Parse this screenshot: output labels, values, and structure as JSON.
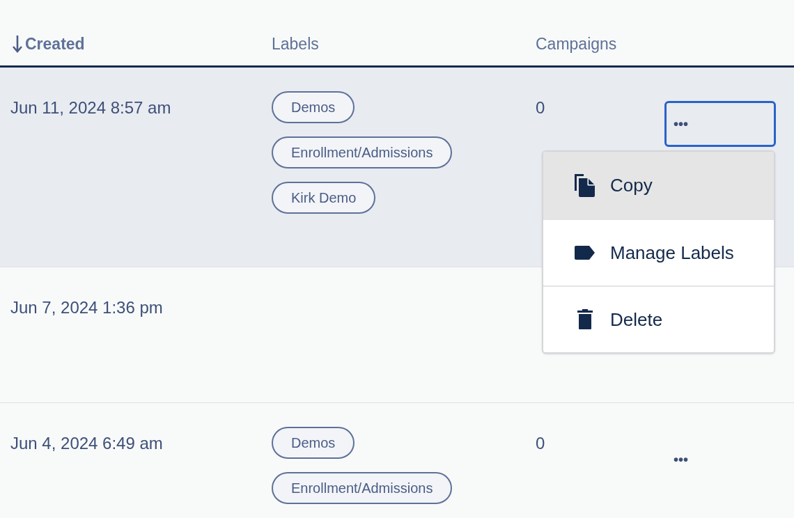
{
  "table": {
    "columns": [
      {
        "label": "Created",
        "sorted": true
      },
      {
        "label": "Labels",
        "sorted": false
      },
      {
        "label": "Campaigns",
        "sorted": false
      }
    ],
    "rows": [
      {
        "created": "Jun 11, 2024 8:57 am",
        "labels": [
          "Demos",
          "Enrollment/Admissions",
          "Kirk Demo"
        ],
        "campaigns": "0",
        "selected": true,
        "actions": {
          "label": "•••",
          "focused": true
        }
      },
      {
        "created": "Jun 7, 2024 1:36 pm",
        "labels": [],
        "selected": false
      },
      {
        "created": "Jun 4, 2024 6:49 am",
        "labels": [
          "Demos",
          "Enrollment/Admissions"
        ],
        "campaigns": "0",
        "selected": false,
        "actions": {
          "label": "•••",
          "focused": false
        }
      }
    ]
  },
  "menu": {
    "items": [
      {
        "label": "Copy",
        "kind": "copy",
        "selected": true
      },
      {
        "label": "Manage Labels",
        "kind": "label",
        "selected": false
      },
      {
        "label": "Delete",
        "kind": "delete",
        "selected": false
      }
    ]
  }
}
